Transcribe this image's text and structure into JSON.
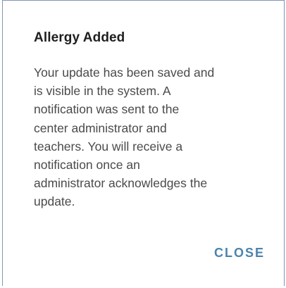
{
  "dialog": {
    "title": "Allergy Added",
    "body_lines": [
      "Your update has been saved and",
      "is visible in the system. A",
      "notification was sent to the",
      "center administrator and",
      "teachers. You will receive a",
      "notification once an",
      "administrator acknowledges the",
      "update."
    ],
    "close_label": "CLOSE"
  },
  "colors": {
    "accent": "#4b83ac",
    "title_text": "#1f1f1f",
    "body_text": "#4a4a4a",
    "frame_border": "#7d95b6"
  }
}
